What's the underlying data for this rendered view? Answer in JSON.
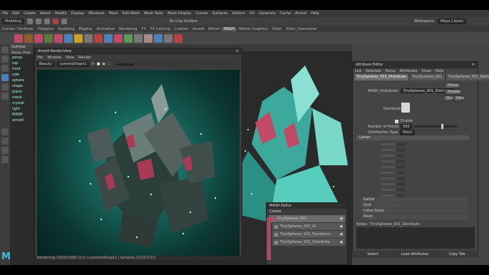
{
  "menubar": {
    "items": [
      "File",
      "Edit",
      "Create",
      "Select",
      "Modify",
      "Display",
      "Windows",
      "Mesh",
      "Edit Mesh",
      "Mesh Tools",
      "Mesh Display",
      "Curves",
      "Surfaces",
      "Deform",
      "UV",
      "Generate",
      "Cache",
      "Arnold",
      "Help"
    ],
    "workspace_label": "Workspace:",
    "workspace_value": "Maya Classic"
  },
  "statusline": {
    "mode": "Modeling",
    "live_surface": "No Live Surface"
  },
  "shelf": {
    "tabs": [
      "Curves / Surfaces",
      "Polygons",
      "Sculpting",
      "Rigging",
      "Animation",
      "Rendering",
      "FX",
      "FX Caching",
      "Custom",
      "Arnold",
      "Bifrost",
      "MASH",
      "Motion Graphics",
      "XGen",
      "XGen_Interactive"
    ],
    "active_tab": "MASH"
  },
  "outliner": {
    "title": "Outliner",
    "menu": "Display  Show",
    "items": [
      "persp",
      "top",
      "front",
      "side",
      "sphere",
      "shape",
      "plane",
      "mesh",
      "crystal",
      "light",
      "MASH",
      "arnold"
    ]
  },
  "render_view": {
    "title": "Arnold RenderView",
    "menu": [
      "File",
      "Window",
      "View",
      "Render"
    ],
    "camera": "Beauty",
    "crop": "cameraShape1",
    "status": "Rendering 1920x1080 (1:1) | cameraShape1 | samples 3/2/2/2/2/2"
  },
  "attribute_editor": {
    "title": "Attribute Editor",
    "menu": [
      "List",
      "Selected",
      "Focus",
      "Attributes",
      "Show",
      "Help"
    ],
    "tabs": [
      "TinySpheres_001_Distribute",
      "TinySpheres_001",
      "TinySpheres_001_Waiter"
    ],
    "active_tab": "TinySpheres_001_Distribute",
    "mash_label": "MASH_Distribute:",
    "mash_value": "TinySpheres_001_Distribute",
    "focus_btn": "Focus",
    "presets_btn": "Presets",
    "show_btn": "Show",
    "hide_btn": "Hide",
    "distribute_label": "Distribute",
    "enable_label": "Enable",
    "points_label": "Number of Points",
    "points_value": "500",
    "dist_type_label": "Distribution Type",
    "dist_type_value": "Mesh",
    "section_linear": "Linear",
    "section_items": [
      "Radial",
      "Grid",
      "Initial State",
      "Mesh"
    ],
    "notes_label": "Notes:",
    "notes_value": "TinySpheres_001_Distribute",
    "bottom": [
      "Select",
      "Load Attributes",
      "Copy Tab"
    ]
  },
  "mash_editor": {
    "title": "MASH Editor",
    "create_label": "Create",
    "rows": [
      {
        "label": "TinySpheres_001",
        "selected": true
      },
      {
        "label": "TinySpheres_001_ID",
        "selected": false
      },
      {
        "label": "TinySpheres_001_Transform",
        "selected": false
      },
      {
        "label": "TinySpheres_001_Distribute",
        "selected": false
      }
    ]
  },
  "colors": {
    "accent": "#4f7fb7",
    "mash_tab": "#c14a68",
    "crystal": "#3fbfb0",
    "bg": "#444444"
  }
}
